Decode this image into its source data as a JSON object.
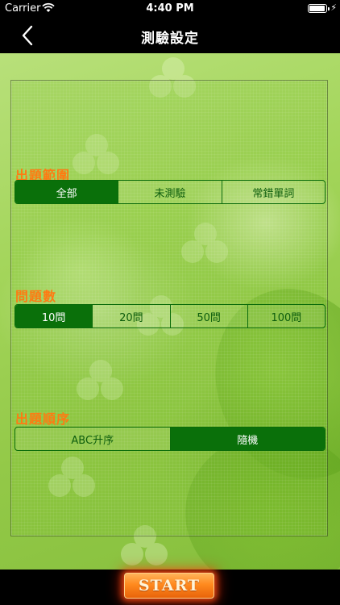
{
  "status_bar": {
    "carrier": "Carrier",
    "time": "4:40 PM",
    "wifi_icon": "wifi-icon",
    "battery_icon": "battery-icon",
    "charging_icon": "bolt-icon",
    "battery_level": 0.85
  },
  "nav": {
    "title": "測驗設定",
    "back_icon": "chevron-left-icon"
  },
  "sections": [
    {
      "label": "出題範圍",
      "options": [
        "全部",
        "未測驗",
        "常錯單詞"
      ],
      "selected_index": 0
    },
    {
      "label": "問題數",
      "options": [
        "10問",
        "20問",
        "50問",
        "100問"
      ],
      "selected_index": 0
    },
    {
      "label": "出題順序",
      "options": [
        "ABC升序",
        "隨機"
      ],
      "selected_index": 1
    }
  ],
  "start_button": {
    "label": "START"
  },
  "colors": {
    "accent_green": "#0a700a",
    "section_label": "#ff7a12",
    "start_orange": "#ff8a1e"
  }
}
